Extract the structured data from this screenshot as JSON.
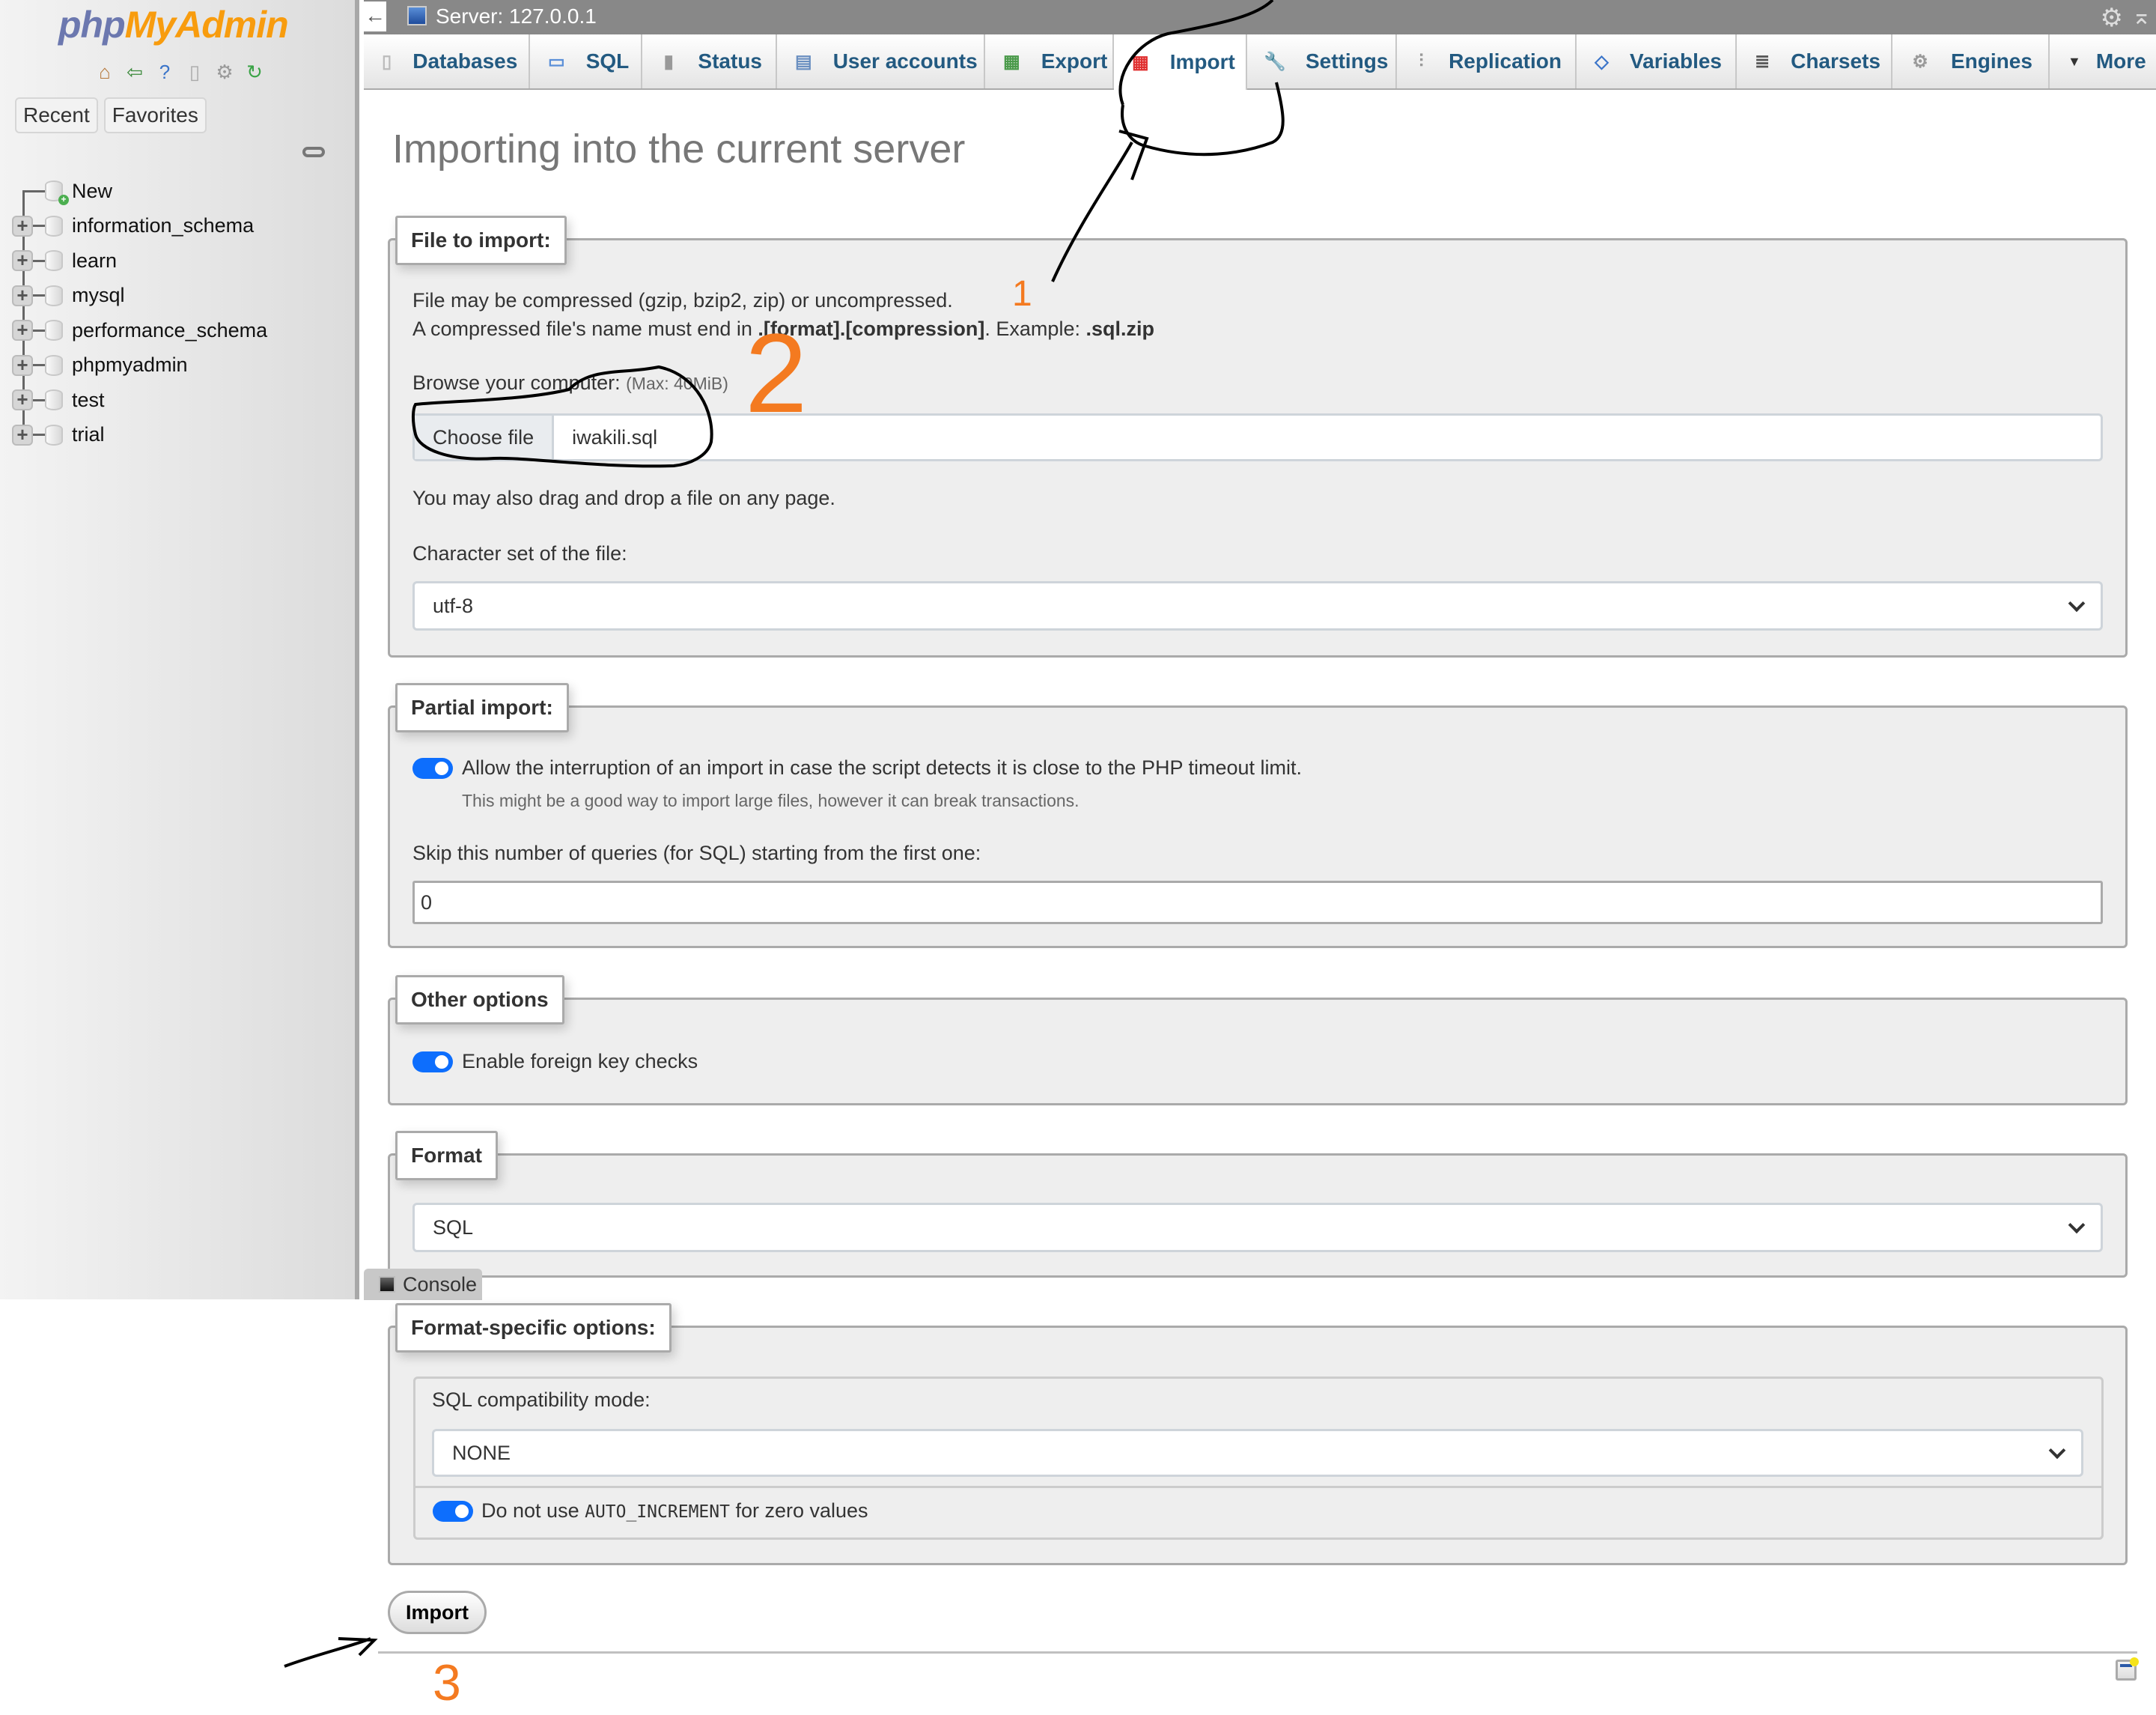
{
  "sidebar": {
    "logo": {
      "part1": "php",
      "part2": "MyAdmin"
    },
    "nav_icons": [
      "home-icon",
      "logout-icon",
      "help-icon",
      "docs-icon",
      "settings-icon",
      "reload-icon"
    ],
    "tabs": [
      {
        "label": "Recent"
      },
      {
        "label": "Favorites"
      }
    ],
    "tree": [
      {
        "label": "New",
        "type": "new"
      },
      {
        "label": "information_schema",
        "type": "db"
      },
      {
        "label": "learn",
        "type": "db"
      },
      {
        "label": "mysql",
        "type": "db"
      },
      {
        "label": "performance_schema",
        "type": "db"
      },
      {
        "label": "phpmyadmin",
        "type": "db"
      },
      {
        "label": "test",
        "type": "db"
      },
      {
        "label": "trial",
        "type": "db"
      }
    ]
  },
  "topbar": {
    "back_icon": "←",
    "server_label": "Server: 127.0.0.1",
    "gear_icon": "⚙",
    "collapse_icon": "⌅"
  },
  "tabs": [
    {
      "label": "Databases",
      "icon": "database-icon",
      "glyph": "▯",
      "active": false
    },
    {
      "label": "SQL",
      "icon": "sql-icon",
      "glyph": "▭",
      "active": false
    },
    {
      "label": "Status",
      "icon": "status-icon",
      "glyph": "▮",
      "active": false
    },
    {
      "label": "User accounts",
      "icon": "user-accounts-icon",
      "glyph": "▤",
      "active": false
    },
    {
      "label": "Export",
      "icon": "export-icon",
      "glyph": "▦",
      "active": false
    },
    {
      "label": "Import",
      "icon": "import-icon",
      "glyph": "▦",
      "active": true
    },
    {
      "label": "Settings",
      "icon": "settings-wrench-icon",
      "glyph": "🔧",
      "active": false
    },
    {
      "label": "Replication",
      "icon": "replication-icon",
      "glyph": "⫶",
      "active": false
    },
    {
      "label": "Variables",
      "icon": "variables-icon",
      "glyph": "◇",
      "active": false
    },
    {
      "label": "Charsets",
      "icon": "charsets-icon",
      "glyph": "≣",
      "active": false
    },
    {
      "label": "Engines",
      "icon": "engines-icon",
      "glyph": "⚙",
      "active": false
    },
    {
      "label": "More",
      "icon": "more-dropdown-icon",
      "glyph": "▼",
      "active": false
    }
  ],
  "main": {
    "title": "Importing into the current server",
    "file_section": {
      "legend": "File to import:",
      "line1": "File may be compressed (gzip, bzip2, zip) or uncompressed.",
      "line2_prefix": "A compressed file's name must end in ",
      "line2_bold": ".[format].[compression]",
      "line2_mid": ". Example: ",
      "line2_example": ".sql.zip",
      "browse_label": "Browse your computer:",
      "max_size": "(Max: 40MiB)",
      "choose_button": "Choose file",
      "file_name": "iwakili.sql",
      "drag_note": "You may also drag and drop a file on any page.",
      "charset_label": "Character set of the file:",
      "charset_value": "utf-8"
    },
    "partial_section": {
      "legend": "Partial import:",
      "allow_interrupt_label": "Allow the interruption of an import in case the script detects it is close to the PHP timeout limit.",
      "allow_interrupt_checked": true,
      "allow_interrupt_note": "This might be a good way to import large files, however it can break transactions.",
      "skip_label": "Skip this number of queries (for SQL) starting from the first one:",
      "skip_value": "0"
    },
    "other_section": {
      "legend": "Other options",
      "fk_label": "Enable foreign key checks",
      "fk_checked": true
    },
    "format_section": {
      "legend": "Format",
      "value": "SQL"
    },
    "format_specific_section": {
      "legend": "Format-specific options:",
      "compat_label": "SQL compatibility mode:",
      "compat_value": "NONE",
      "auto_inc_prefix": "Do not use ",
      "auto_inc_code": "AUTO_INCREMENT",
      "auto_inc_suffix": " for zero values",
      "auto_inc_checked": true
    },
    "import_button": "Import",
    "console_label": "Console"
  },
  "annotations": {
    "step1": "1",
    "step2": "2",
    "step3": "3",
    "ink_color": "#000000",
    "number_color": "#f47a20"
  }
}
